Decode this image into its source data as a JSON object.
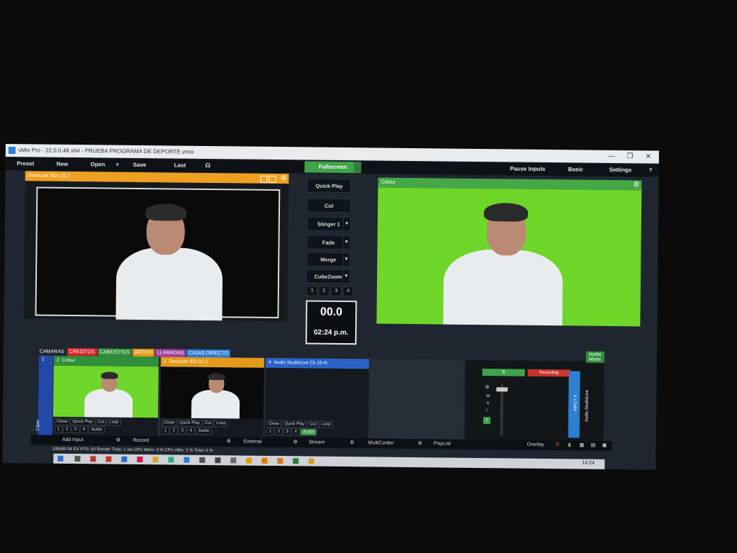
{
  "window": {
    "title": "vMix Pro - 22.0.0.48 x64 - PRUEBA PROGRAMA DE DEPORTE.vmix"
  },
  "menu": {
    "items": [
      "Preset",
      "New",
      "Open",
      "Save",
      "Last"
    ],
    "fullscreen": "Fullscreen",
    "right": [
      "Pause Inputs",
      "Basic",
      "Settings",
      "?"
    ]
  },
  "preview": {
    "label": "DeckLink SDI (2) 2"
  },
  "output": {
    "label": "Colour"
  },
  "transitions": {
    "quick_play": "Quick Play",
    "cut": "Cut",
    "stinger": "Stinger 1",
    "fade": "Fade",
    "merge": "Merge",
    "cubezoom": "CubeZoom",
    "numbers": [
      "1",
      "2",
      "3",
      "4"
    ]
  },
  "timer": {
    "value": "00.0",
    "clock": "02:24 p.m."
  },
  "tabs": [
    {
      "label": "CAMARAS",
      "color": "#1f2630"
    },
    {
      "label": "CREDITOS",
      "color": "#d4262a"
    },
    {
      "label": "CABEZOTES",
      "color": "#2f8f3b"
    },
    {
      "label": "APOYO",
      "color": "#e39a1a"
    },
    {
      "label": "LLAMADAS",
      "color": "#a43ea8"
    },
    {
      "label": "CAJAS DIRECTO",
      "color": "#2d7fd1"
    }
  ],
  "inputs": [
    {
      "num": "1",
      "label": "",
      "color": "#2248a8"
    },
    {
      "num": "2",
      "label": "Colour",
      "color": "#2f8f3b"
    },
    {
      "num": "3",
      "label": "DeckLink SDI (2) 2",
      "color": "#e39a1a"
    },
    {
      "num": "4",
      "label": "Audio StudioLive Ch 15+6",
      "color": "#2b63c6"
    }
  ],
  "input_controls": [
    "Close",
    "Quick Play",
    "Cut",
    "Loop"
  ],
  "input_nums": [
    "1",
    "2",
    "3",
    "4"
  ],
  "audio_label": "Audio",
  "side_label": "Cajas",
  "mixer": {
    "title": "Audio Mixer",
    "recording": "Recording",
    "b_label": "B",
    "ms": [
      "M",
      "S",
      "I"
    ],
    "input_label": "INPUT 4",
    "device_label": "Audio StudioLive"
  },
  "bottom": {
    "add_input": "Add Input",
    "record": "Record",
    "external": "External",
    "stream": "Stream",
    "multicorder": "MultiCorder",
    "playlist": "PlayList",
    "overlay": "Overlay"
  },
  "status": {
    "text": "108659.54   EX  FPS: 60  Render Time: 1 ms  GPU Mem: 3 %  CPU vMix: 2 %  Total: 6 %"
  },
  "taskbar": {
    "time": "14:24"
  }
}
